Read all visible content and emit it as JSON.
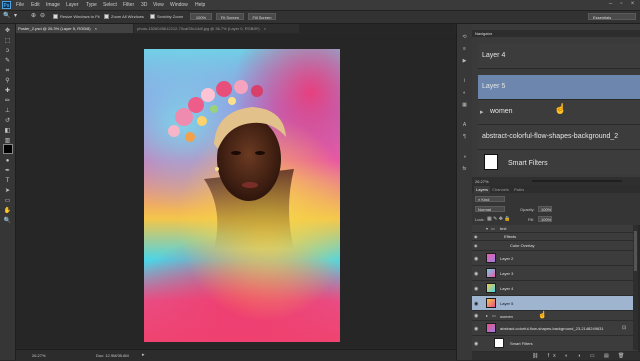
{
  "menubar": {
    "logo": "Ps",
    "items": [
      "File",
      "Edit",
      "Image",
      "Layer",
      "Type",
      "Select",
      "Filter",
      "3D",
      "View",
      "Window",
      "Help"
    ]
  },
  "options": {
    "resize_windows": "Resize Windows to Fit",
    "zoom_all": "Zoom All Windows",
    "scrubby": "Scrubby Zoom",
    "zoom_100": "100%",
    "fit_screen": "Fit Screen",
    "fill_screen": "Fill Screen",
    "workspace": "Essentials"
  },
  "tabs": [
    {
      "label": "Poster_2.psd @ 26.3% (Layer 5, RGB/8)",
      "close": "×"
    },
    {
      "label": "photo-1526045612212-70caf35c14df.jpg @ 36.7% (Layer 0, RGB/8*)",
      "close": "×"
    }
  ],
  "status": {
    "zoom": "26.27%",
    "doc": "Doc: 12.9M/35.6M"
  },
  "navigator": {
    "title": "Navigator",
    "items": [
      {
        "label": "Layer 4"
      },
      {
        "label": "Layer 5"
      },
      {
        "label": "women"
      },
      {
        "label": "abstract-colorful-flow-shapes-background_2"
      },
      {
        "label": "Smart Filters"
      }
    ],
    "zoom": "26.27%"
  },
  "layers_panel": {
    "tabs": [
      "Layers",
      "Channels",
      "Paths"
    ],
    "kind": "Kind",
    "blend": "Normal",
    "opacity_label": "Opacity:",
    "opacity": "100%",
    "lock_label": "Lock:",
    "fill_label": "Fill:",
    "fill": "100%",
    "layers": [
      {
        "name": "text",
        "type": "group"
      },
      {
        "name": "Effects",
        "type": "effect"
      },
      {
        "name": "Color Overlay",
        "type": "effect"
      },
      {
        "name": "Layer 2",
        "type": "layer"
      },
      {
        "name": "Layer 3",
        "type": "layer"
      },
      {
        "name": "Layer 4",
        "type": "layer"
      },
      {
        "name": "Layer 5",
        "type": "layer",
        "selected": true
      },
      {
        "name": "women",
        "type": "group"
      },
      {
        "name": "abstract-colorful-flow-shapes-background_23-2148249631",
        "type": "smart"
      },
      {
        "name": "Smart Filters",
        "type": "filter"
      }
    ]
  },
  "colors": {
    "accent": "#4fa3e0",
    "selected_layer": "#9fb4cf"
  }
}
